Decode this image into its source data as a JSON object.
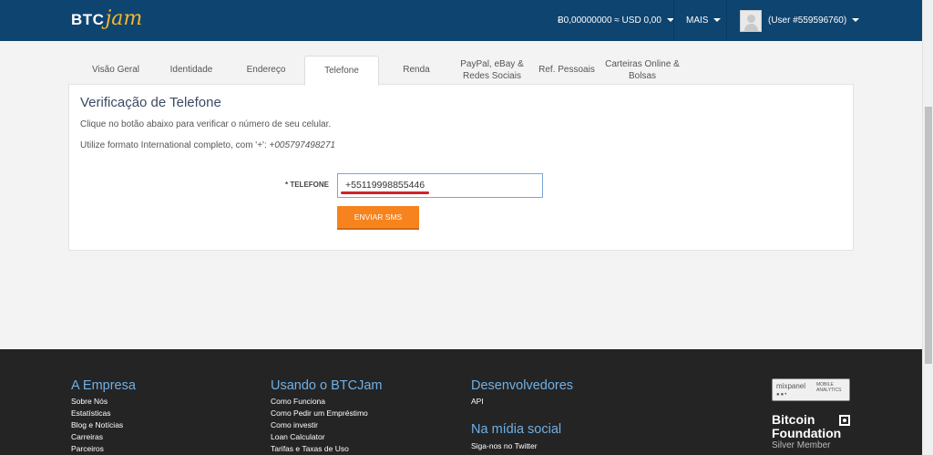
{
  "navbar": {
    "logo_btc": "BTC",
    "logo_jam": "jam",
    "balance": "Ƀ0,00000000 ≈ USD 0,00",
    "mais": "MAIS",
    "user": "(User #559596760)"
  },
  "tabs": [
    {
      "label": "Visão Geral"
    },
    {
      "label": "Identidade"
    },
    {
      "label": "Endereço"
    },
    {
      "label": "Telefone"
    },
    {
      "label": "Renda"
    },
    {
      "label": "PayPal, eBay & Redes Sociais"
    },
    {
      "label": "Ref. Pessoais"
    },
    {
      "label": "Carteiras Online & Bolsas"
    }
  ],
  "panel": {
    "title": "Verificação de Telefone",
    "description": "Clique no botão abaixo para verificar o número de seu celular.",
    "format_text": "Utilize formato International completo, com '+': ",
    "format_example": "+005797498271",
    "phone_label": "* TELEFONE",
    "phone_value": "+55119998855446",
    "sms_button": "ENVIAR SMS"
  },
  "footer": {
    "empresa": {
      "heading": "A Empresa",
      "links": [
        "Sobre Nós",
        "Estatísticas",
        "Blog e Notícias",
        "Carreiras",
        "Parceiros"
      ]
    },
    "usando": {
      "heading": "Usando o BTCJam",
      "links": [
        "Como Funciona",
        "Como Pedir um Empréstimo",
        "Como investir",
        "Loan Calculator",
        "Tarifas e Taxas de Uso"
      ]
    },
    "dev": {
      "heading": "Desenvolvedores",
      "links": [
        "API"
      ]
    },
    "midia": {
      "heading": "Na mídia social",
      "links": [
        "Siga-nos no Twitter"
      ]
    },
    "mixpanel": {
      "name": "mixpanel",
      "sub1": "MOBILE",
      "sub2": "ANALYTICS"
    },
    "bitcoin_foundation": {
      "line1": "Bitcoin",
      "line2": "Foundation",
      "line3": "Silver Member"
    }
  },
  "colors": {
    "navbar": "#0e4470",
    "accent_orange": "#f6831e",
    "footer_heading": "#6fb0e8",
    "logo_jam": "#f6b826"
  }
}
